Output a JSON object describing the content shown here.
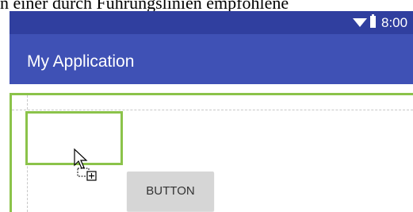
{
  "caption": {
    "text": "n einer durch Führungslinien empfohlene"
  },
  "status_bar": {
    "time": "8:00",
    "icons": [
      "wifi-icon",
      "battery-icon"
    ],
    "color": "#303f9f"
  },
  "app_bar": {
    "title": "My Application",
    "color": "#3f51b5"
  },
  "layout": {
    "highlight_color": "#8bc34a",
    "button_label": "BUTTON"
  },
  "cursor": {
    "icon": "drag-add-cursor-icon"
  }
}
